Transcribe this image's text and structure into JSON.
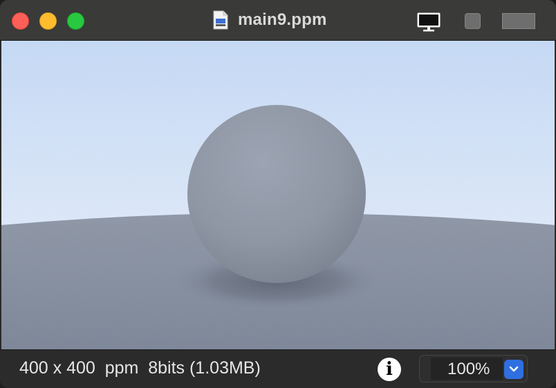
{
  "window": {
    "title": "main9.ppm",
    "traffic_lights": {
      "close": "#fe5f57",
      "minimize": "#febc2e",
      "zoom": "#28c840"
    },
    "toolbar_icons": [
      "monitor-icon",
      "square-icon",
      "wide-rect-icon"
    ]
  },
  "image": {
    "description_icon": "rendered-sphere-image",
    "sky_top_color": "#c9dcf7",
    "sky_bottom_color": "#f0f5fd",
    "ground_color": "#8790a0",
    "sphere_color": "#8e96a4"
  },
  "status": {
    "info_text": "400 x 400  ppm  8bits (1.03MB)",
    "info_icon_glyph": "i",
    "zoom_value": "100%",
    "zoom_accent": "#2f6fe0"
  }
}
